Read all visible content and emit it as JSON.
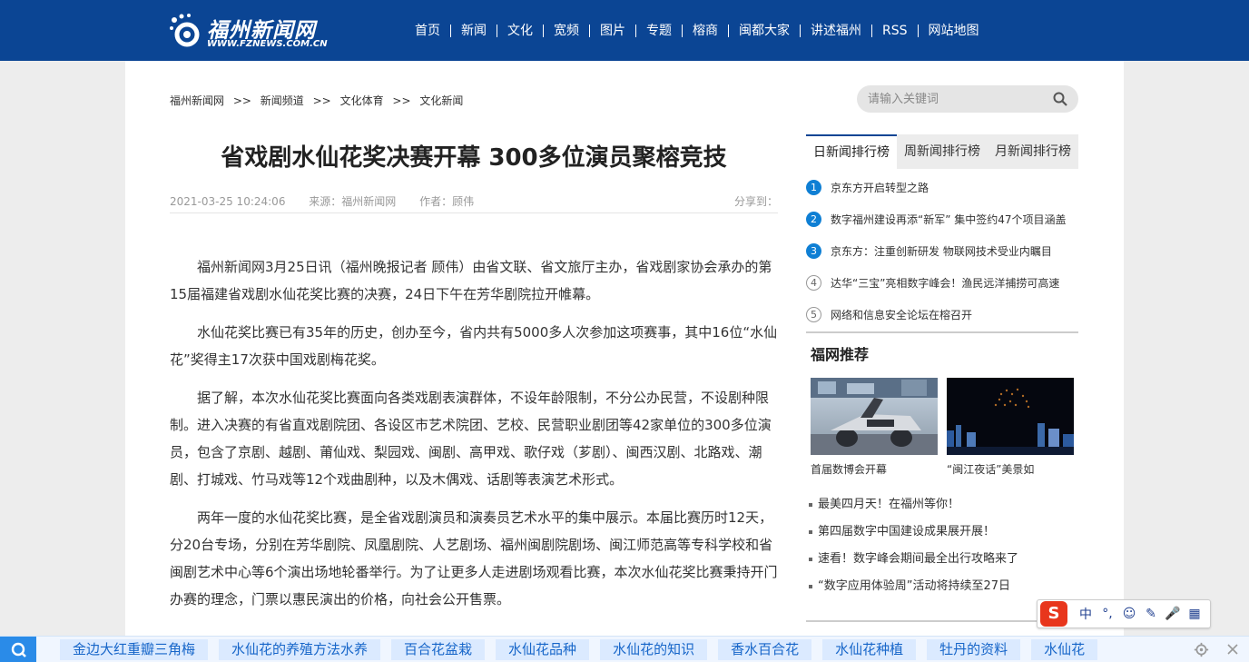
{
  "header": {
    "logo_cn": "福州新闻网",
    "logo_en": "WWW.FZNEWS.COM.CN",
    "nav": [
      "首页",
      "新闻",
      "文化",
      "宽频",
      "图片",
      "专题",
      "榕商",
      "闽都大家",
      "讲述福州",
      "RSS",
      "网站地图"
    ]
  },
  "breadcrumb": [
    "福州新闻网",
    "新闻频道",
    "文化体育",
    "文化新闻"
  ],
  "breadcrumb_sep": ">>",
  "search": {
    "placeholder": "请输入关键词"
  },
  "article": {
    "title": "省戏剧水仙花奖决赛开幕 300多位演员聚榕竞技",
    "date": "2021-03-25 10:24:06",
    "source": "来源：福州新闻网",
    "author": "作者：顾伟",
    "share": "分享到：",
    "paragraphs": [
      "福州新闻网3月25日讯（福州晚报记者 顾伟）由省文联、省文旅厅主办，省戏剧家协会承办的第15届福建省戏剧水仙花奖比赛的决赛，24日下午在芳华剧院拉开帷幕。",
      "水仙花奖比赛已有35年的历史，创办至今，省内共有5000多人次参加这项赛事，其中16位“水仙花”奖得主17次获中国戏剧梅花奖。",
      "据了解，本次水仙花奖比赛面向各类戏剧表演群体，不设年龄限制，不分公办民营，不设剧种限制。进入决赛的有省直戏剧院团、各设区市艺术院团、艺校、民营职业剧团等42家单位的300多位演员，包含了京剧、越剧、莆仙戏、梨园戏、闽剧、高甲戏、歌仔戏（芗剧）、闽西汉剧、北路戏、潮剧、打城戏、竹马戏等12个戏曲剧种，以及木偶戏、话剧等表演艺术形式。",
      "两年一度的水仙花奖比赛，是全省戏剧演员和演奏员艺术水平的集中展示。本届比赛历时12天，分20台专场，分别在芳华剧院、凤凰剧院、人艺剧场、福州闽剧院剧场、闽江师范高等专科学校和省闽剧艺术中心等6个演出场地轮番举行。为了让更多人走进剧场观看比赛，本次水仙花奖比赛秉持开门办赛的理念，门票以惠民演出的价格，向社会公开售票。"
    ]
  },
  "ranking": {
    "tabs": [
      "日新闻排行榜",
      "周新闻排行榜",
      "月新闻排行榜"
    ],
    "items": [
      {
        "num": "1",
        "text": "京东方开启转型之路"
      },
      {
        "num": "2",
        "text": "数字福州建设再添“新军” 集中签约47个项目涵盖"
      },
      {
        "num": "3",
        "text": "京东方：注重创新研发 物联网技术受业内瞩目"
      },
      {
        "num": "4",
        "text": "达华“三宝”亮相数字峰会！渔民远洋捕捞可高速"
      },
      {
        "num": "5",
        "text": "网络和信息安全论坛在榕召开"
      }
    ]
  },
  "recommend": {
    "title": "福网推荐",
    "pics": [
      {
        "caption": "首届数博会开幕"
      },
      {
        "caption": "“闽江夜话”美景如"
      }
    ],
    "list": [
      "最美四月天！在福州等你！",
      "第四届数字中国建设成果展开展！",
      "速看！数字峰会期间最全出行攻略来了",
      "“数字应用体验周”活动将持续至27日"
    ]
  },
  "ime": {
    "logo": "S",
    "items": [
      "中",
      "°,",
      "☺",
      "✎",
      "🎤",
      "▦"
    ]
  },
  "bottom_tags": [
    "金边大红重瓣三角梅",
    "水仙花的养殖方法水养",
    "百合花盆栽",
    "水仙花品种",
    "水仙花的知识",
    "香水百合花",
    "水仙花种植",
    "牡丹的资料",
    "水仙花"
  ],
  "colors": {
    "header_bg": "#0b4594",
    "accent": "#0f7fd4",
    "bottombar_bg": "#f0f6ff"
  }
}
